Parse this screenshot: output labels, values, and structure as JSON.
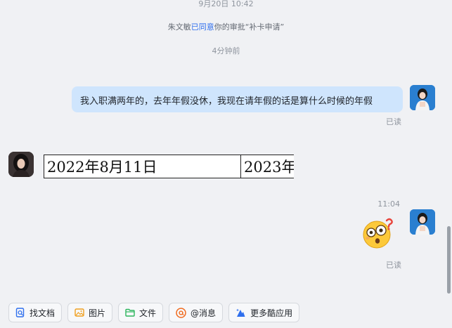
{
  "chat": {
    "timestamp_top": "9月20日 10:42",
    "notice": {
      "prefix": "朱文敏",
      "action": "已同意",
      "suffix": "你的审批“补卡申请”"
    },
    "ago": "4分钟前",
    "my_message": "我入职满两年的，去年年假没休，我现在请年假的话是算什么时候的年假",
    "read_1": "已读",
    "doc_image": {
      "cell_1": "2022年8月11日",
      "cell_2": "2023年"
    },
    "time_2": "11:04",
    "read_2": "已读"
  },
  "toolbar": {
    "find_doc": "找文档",
    "image": "图片",
    "file": "文件",
    "mention": "@消息",
    "more_apps": "更多酷应用"
  },
  "colors": {
    "accent": "#2f6fed",
    "bubble_me": "#cfe5fd",
    "background": "#f0f1f4"
  }
}
